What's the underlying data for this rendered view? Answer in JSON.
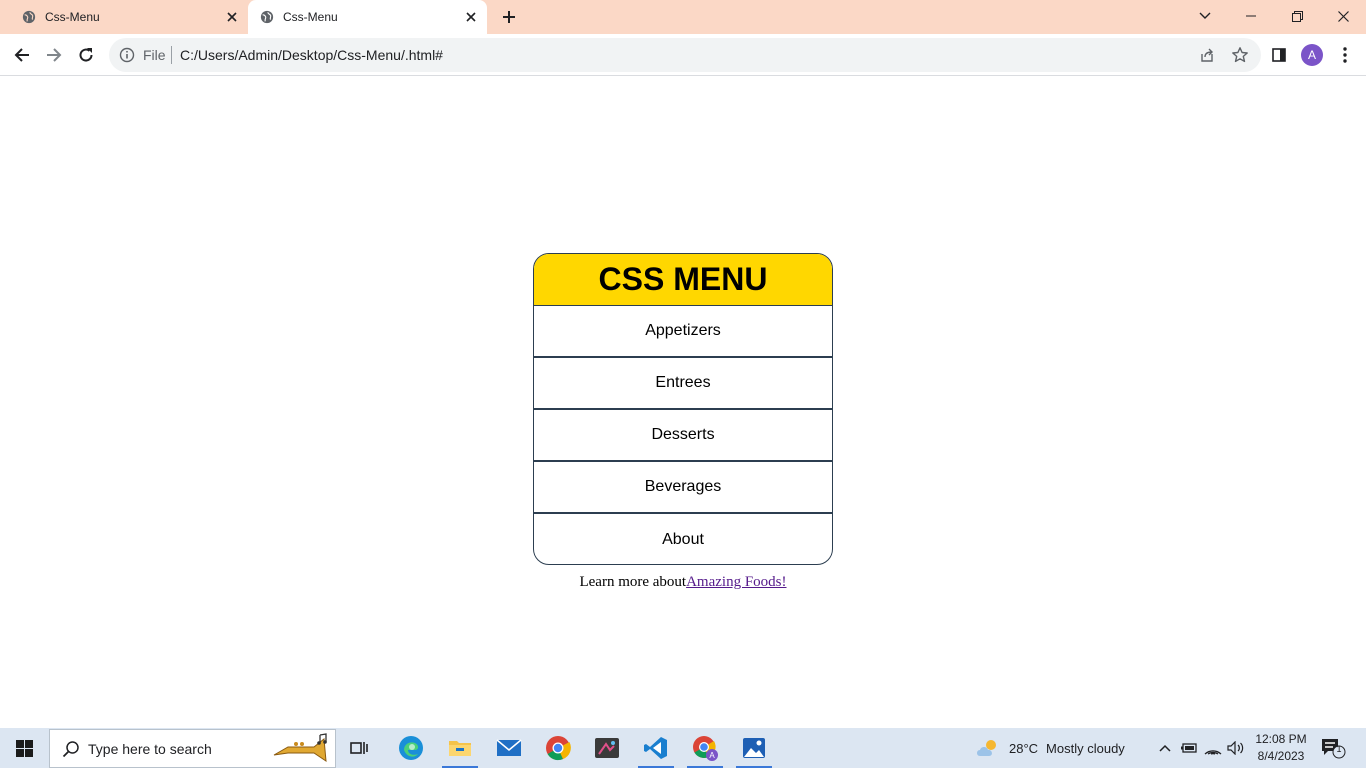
{
  "browser": {
    "tabs": [
      {
        "title": "Css-Menu",
        "active": false
      },
      {
        "title": "Css-Menu",
        "active": true
      }
    ],
    "address": {
      "scheme_label": "File",
      "url": "C:/Users/Admin/Desktop/Css-Menu/.html#"
    },
    "profile_initial": "A",
    "colors": {
      "tabstrip": "#fbd8c6",
      "omnibox": "#f1f3f4",
      "avatar": "#7b54c8"
    }
  },
  "page": {
    "menu": {
      "title": "CSS MENU",
      "items": [
        "Appetizers",
        "Entrees",
        "Desserts",
        "Beverages",
        "About"
      ],
      "header_color": "#ffd700",
      "border_color": "#2c3e50"
    },
    "footer": {
      "text": "Learn more about",
      "link_text": "Amazing Foods!",
      "link_color": "#551a8b"
    }
  },
  "taskbar": {
    "search_placeholder": "Type here to search",
    "weather": {
      "temperature": "28°C",
      "condition": "Mostly cloudy"
    },
    "clock": {
      "time": "12:08 PM",
      "date": "8/4/2023"
    },
    "notification_count": "1",
    "pinned_icons": [
      "task-view-icon",
      "edge-icon",
      "file-explorer-icon",
      "mail-icon",
      "chrome-icon",
      "snipping-tool-icon",
      "vscode-icon",
      "chrome-profile-icon",
      "photos-icon"
    ]
  }
}
